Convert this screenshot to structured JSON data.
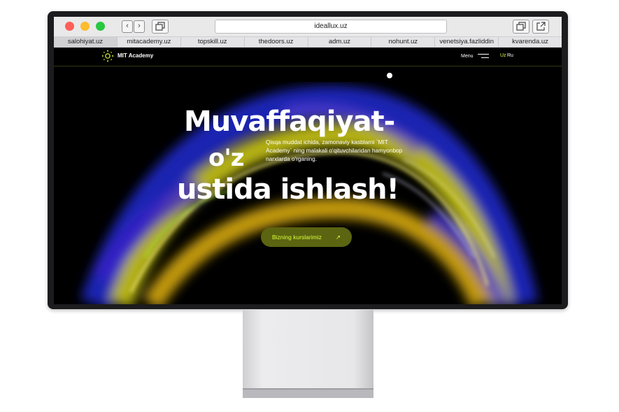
{
  "browser": {
    "url": "ideallux.uz",
    "tabs": [
      "salohiyat.uz",
      "mitacademy.uz",
      "topskill.uz",
      "thedoors.uz",
      "adm.uz",
      "nohunt.uz",
      "venetsiya.fazliddin",
      "kvarenda.uz"
    ],
    "active_tab_index": 0
  },
  "site": {
    "brand": "MIT Academy",
    "menu_label": "Menu",
    "lang_uz": "Uz",
    "lang_ru": "Ru",
    "lang_active_color": "#d9ff3a",
    "hero": {
      "line1": "Muvaffaqiyat-",
      "line2": "o'z",
      "line3": "ustida ishlash!",
      "description": "Qisqa muddat ichida, zamonaviy kasblarni `MIT Academy` ning malakali o'qituvchilaridan hamyonbop narxlarda o'rganing.",
      "cta_label": "Bizning kurslarimiz",
      "cta_icon": "arrow-up-right-icon",
      "accent_color": "#d9ff3a"
    }
  }
}
